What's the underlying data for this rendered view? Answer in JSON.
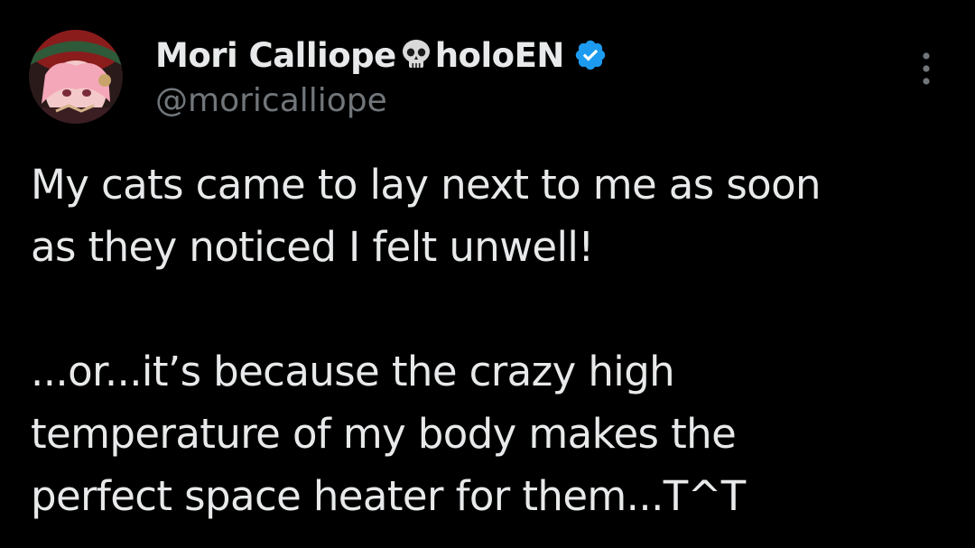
{
  "tweet": {
    "author": {
      "display_name": "Mori Calliope",
      "name_suffix": "holoEN",
      "handle": "@moricalliope",
      "emoji_icon": "skull-icon",
      "verified_icon": "verified-badge-icon"
    },
    "more_icon": "more-vertical-icon",
    "text_lines": [
      "My cats came to lay next to me as soon",
      "as they noticed I felt unwell!",
      "",
      "...or...it’s because the crazy high",
      "temperature of my body makes the",
      "perfect space heater for them...T^T"
    ]
  },
  "colors": {
    "background": "#000000",
    "primary_text": "#e7e9ea",
    "secondary_text": "#71767b",
    "verified_blue": "#1d9bf0"
  }
}
